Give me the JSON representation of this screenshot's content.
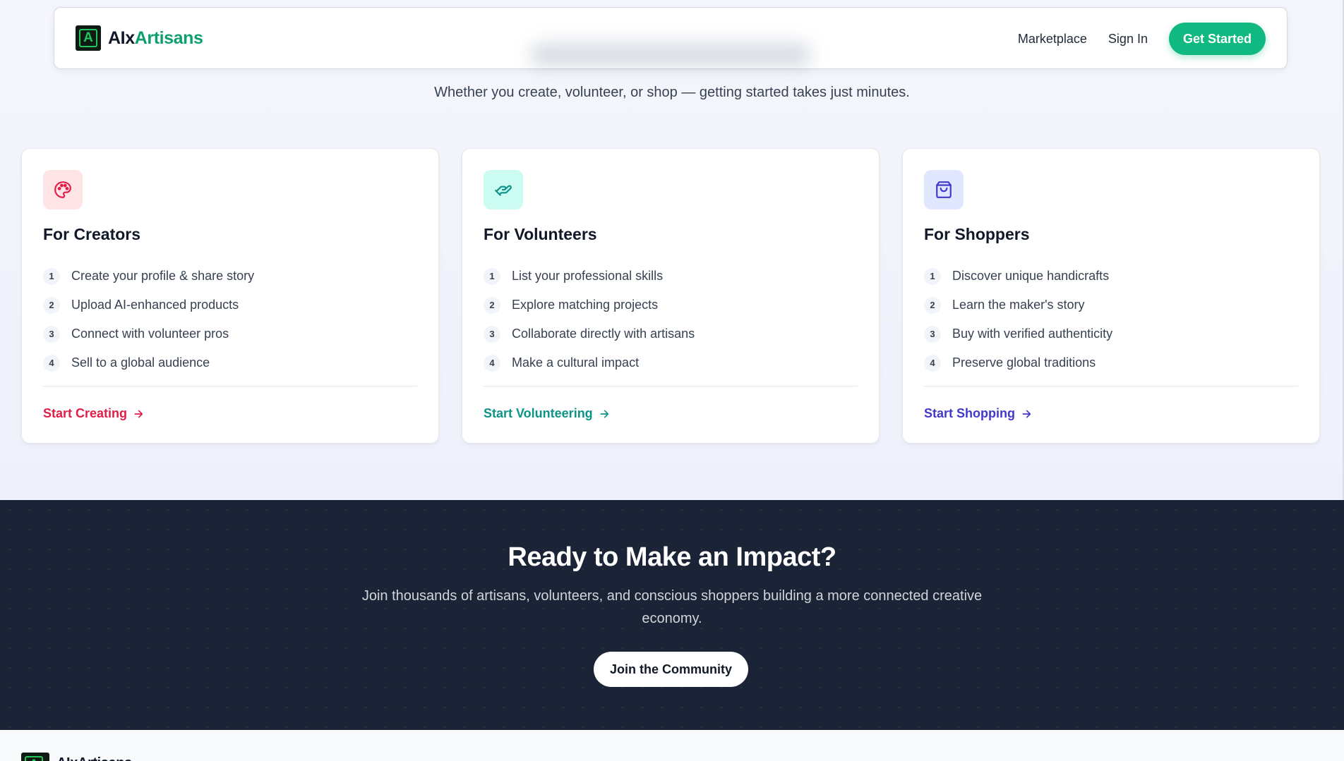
{
  "header": {
    "brand_a": "AIx",
    "brand_b": "Artisans",
    "nav": [
      "Marketplace",
      "Sign In"
    ],
    "cta": "Get Started"
  },
  "intro": {
    "subtitle": "Whether you create, volunteer, or shop — getting started takes just minutes."
  },
  "cards": [
    {
      "title": "For Creators",
      "icon": "palette-icon",
      "accent": "#e11d48",
      "icon_bg": "#ffe4e6",
      "steps": [
        {
          "num": "1",
          "text": "Create your profile & share story"
        },
        {
          "num": "2",
          "text": "Upload AI-enhanced products"
        },
        {
          "num": "3",
          "text": "Connect with volunteer pros"
        },
        {
          "num": "4",
          "text": "Sell to a global audience"
        }
      ],
      "cta": "Start Creating"
    },
    {
      "title": "For Volunteers",
      "icon": "helping-hand-icon",
      "accent": "#0d9488",
      "icon_bg": "#ccfbf1",
      "steps": [
        {
          "num": "1",
          "text": "List your professional skills"
        },
        {
          "num": "2",
          "text": "Explore matching projects"
        },
        {
          "num": "3",
          "text": "Collaborate directly with artisans"
        },
        {
          "num": "4",
          "text": "Make a cultural impact"
        }
      ],
      "cta": "Start Volunteering"
    },
    {
      "title": "For Shoppers",
      "icon": "shopping-bag-icon",
      "accent": "#4338ca",
      "icon_bg": "#e0e7ff",
      "steps": [
        {
          "num": "1",
          "text": "Discover unique handicrafts"
        },
        {
          "num": "2",
          "text": "Learn the maker's story"
        },
        {
          "num": "3",
          "text": "Buy with verified authenticity"
        },
        {
          "num": "4",
          "text": "Preserve global traditions"
        }
      ],
      "cta": "Start Shopping"
    }
  ],
  "cta_section": {
    "title": "Ready to Make an Impact?",
    "text": "Join thousands of artisans, volunteers, and conscious shoppers building a more connected creative economy.",
    "button": "Join the Community"
  },
  "footer": {
    "brand": "AIxArtisans"
  },
  "colors": {
    "brand_green": "#10b981",
    "dark_bg": "#1b2436"
  }
}
